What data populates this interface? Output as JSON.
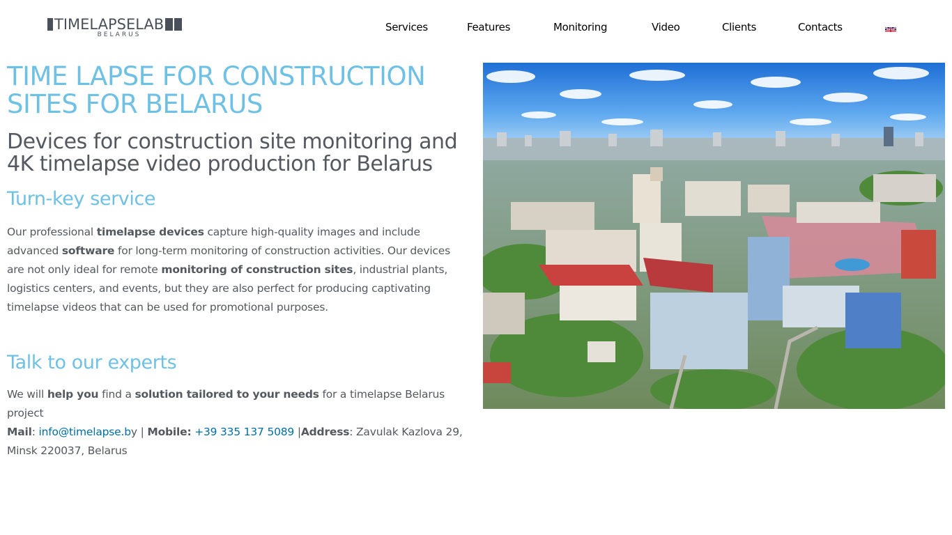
{
  "header": {
    "logo": {
      "main": "TIMELAPSELAB",
      "sub": "BELARUS"
    },
    "nav": [
      {
        "label": "Services"
      },
      {
        "label": "Features"
      },
      {
        "label": "Monitoring"
      },
      {
        "label": "Video"
      },
      {
        "label": "Clients"
      },
      {
        "label": "Contacts"
      }
    ]
  },
  "main": {
    "title": "TIME LAPSE FOR CONSTRUCTION SITES FOR BELARUS",
    "subtitle": "Devices for construction site monitoring and 4K timelapse video production for Belarus",
    "turnkey_heading": "Turn-key service",
    "intro": {
      "p1": "Our professional ",
      "b1": "timelapse devices",
      "p2": " capture high-quality images and include advanced ",
      "b2": "software",
      "p3": " for long-term monitoring of construction activities. Our devices are not only ideal for remote ",
      "b3": "monitoring of construction sites",
      "p4": ", industrial plants, logistics centers, and events, but they are also perfect for producing captivating timelapse videos that can be used for promotional purposes."
    },
    "experts_heading": "Talk to our experts",
    "contact": {
      "p1": "We will ",
      "b1": "help you",
      "p2": " find a ",
      "b2": "solution tailored to your needs",
      "p3": " for a timelapse Belarus project",
      "mail_label": "Mail",
      "mail_sep": ": ",
      "mail_link": "info@timelapse.b",
      "mail_after": "y | ",
      "mobile_label": "Mobile:",
      "mobile_link": "+39 335 137 5089",
      "mobile_after": " |",
      "address_label": "Address",
      "address_value": ": Zavulak Kazlova 29, Minsk 220037, Belarus"
    }
  },
  "colors": {
    "accent": "#6ec1e4",
    "text": "#54595f",
    "link": "#006fa4",
    "logo": "#4a5059"
  },
  "icons": {
    "language_flag": "uk-flag-icon"
  }
}
